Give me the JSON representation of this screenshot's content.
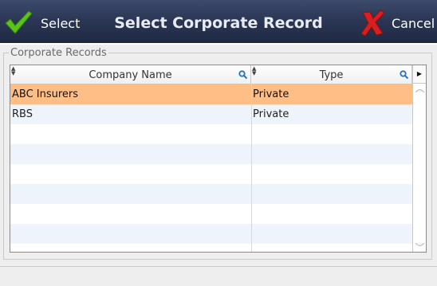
{
  "toolbar": {
    "select_label": "Select",
    "title": "Select Corporate Record",
    "cancel_label": "Cancel"
  },
  "group": {
    "legend": "Corporate Records"
  },
  "grid": {
    "columns": [
      "Company Name",
      "Type"
    ],
    "rows": [
      {
        "company": "ABC Insurers",
        "type": "Private",
        "selected": true
      },
      {
        "company": "RBS",
        "type": "Private",
        "selected": false
      }
    ]
  },
  "icons": {
    "select": "checkmark-icon",
    "cancel": "x-icon",
    "column_search": "magnifier-icon",
    "sort": "sort-icon"
  },
  "colors": {
    "titlebar": "#2b3755",
    "selected_row": "#ffbe85",
    "alt_row": "#eef4fb",
    "check_green": "#5ac21b",
    "cancel_red": "#d62020"
  }
}
